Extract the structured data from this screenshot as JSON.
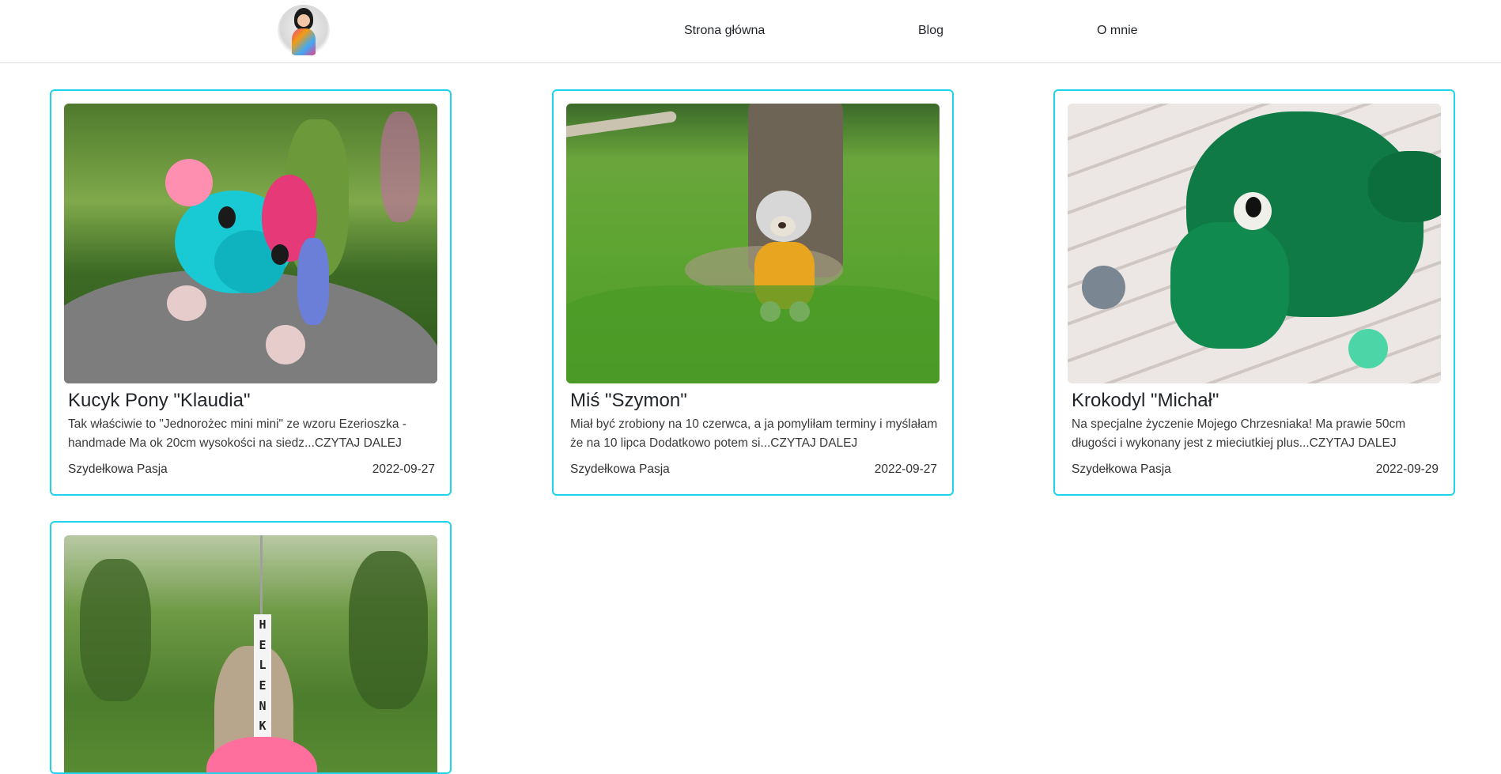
{
  "nav": {
    "logo_alt": "Szydełkowa Pasja logo",
    "links": [
      "Strona główna",
      "Blog",
      "O mnie"
    ]
  },
  "posts": [
    {
      "title": "Kucyk Pony \"Klaudia\"",
      "excerpt": "Tak właściwie to \"Jednorożec mini mini\" ze wzoru Ezerioszka - handmade Ma ok 20cm wysokości na siedz...CZYTAJ DALEJ",
      "author": "Szydełkowa Pasja",
      "date": "2022-09-27"
    },
    {
      "title": "Miś \"Szymon\"",
      "excerpt": "Miał być zrobiony na 10 czerwca, a ja pomyliłam terminy i myślałam że na 10 lipca Dodatkowo potem si...CZYTAJ DALEJ",
      "author": "Szydełkowa Pasja",
      "date": "2022-09-27"
    },
    {
      "title": "Krokodyl \"Michał\"",
      "excerpt": "Na specjalne życzenie Mojego Chrzesniaka! Ma prawie 50cm długości i wykonany jest z mieciutkiej plus...CZYTAJ DALEJ",
      "author": "Szydełkowa Pasja",
      "date": "2022-09-29"
    },
    {
      "keychain_letters": "HELENKA"
    }
  ],
  "colors": {
    "card_border": "#1fd3ec",
    "text": "#212529"
  }
}
